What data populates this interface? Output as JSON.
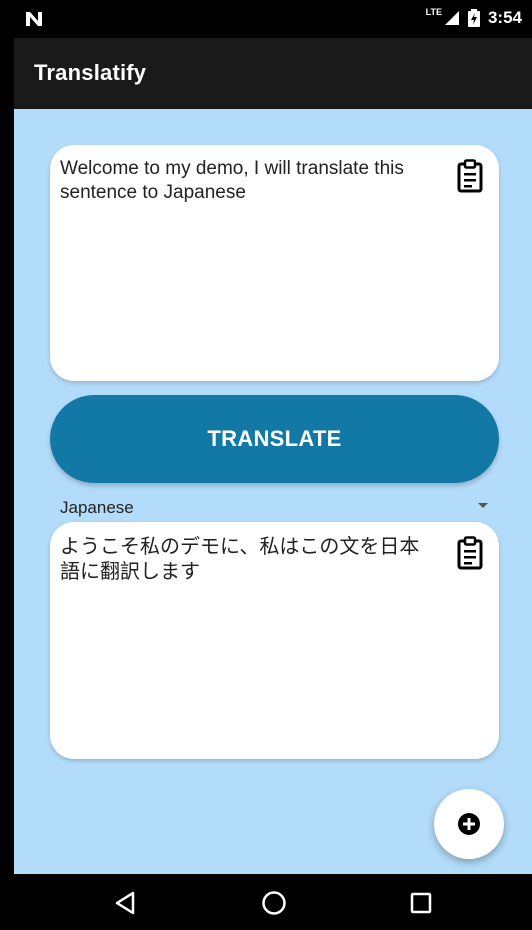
{
  "status_bar": {
    "time": "3:54",
    "network": "LTE"
  },
  "app_bar": {
    "title": "Translatify"
  },
  "source_card": {
    "text": "Welcome to my demo, I will translate this sentence to Japanese"
  },
  "translate_button": {
    "label": "TRANSLATE"
  },
  "language_select": {
    "selected": "Japanese"
  },
  "result_card": {
    "text": "ようこそ私のデモに、私はこの文を日本語に翻訳します"
  },
  "colors": {
    "app_bar_bg": "#1a1a1a",
    "content_bg": "#b3dcfa",
    "button_bg": "#1279a6"
  },
  "icons": {
    "copy": "clipboard-icon",
    "fab": "add-circle-icon",
    "nav_back": "back-triangle-icon",
    "nav_home": "home-circle-icon",
    "nav_recents": "recents-square-icon"
  }
}
